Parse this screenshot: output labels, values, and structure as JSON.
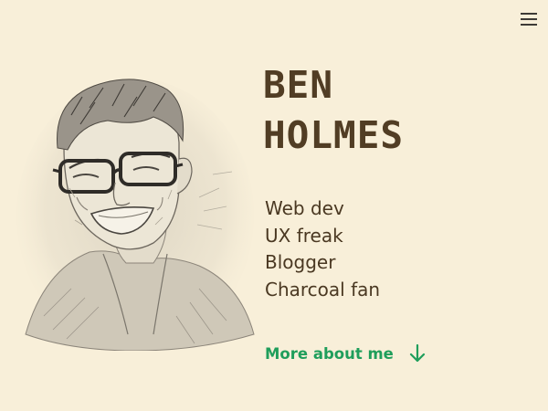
{
  "nav": {
    "menu_icon": "hamburger-menu-icon"
  },
  "hero": {
    "portrait_icon": "charcoal-portrait-sketch",
    "name_line1": "BEN",
    "name_line2": "HOLMES",
    "roles": [
      "Web dev",
      "UX freak",
      "Blogger",
      "Charcoal fan"
    ],
    "cta_label": "More about me",
    "cta_icon": "arrow-down-icon"
  },
  "colors": {
    "background": "#f8efd9",
    "heading": "#513d24",
    "text": "#4a3822",
    "accent": "#1f9e5b",
    "menu_icon": "#3d3a36"
  }
}
